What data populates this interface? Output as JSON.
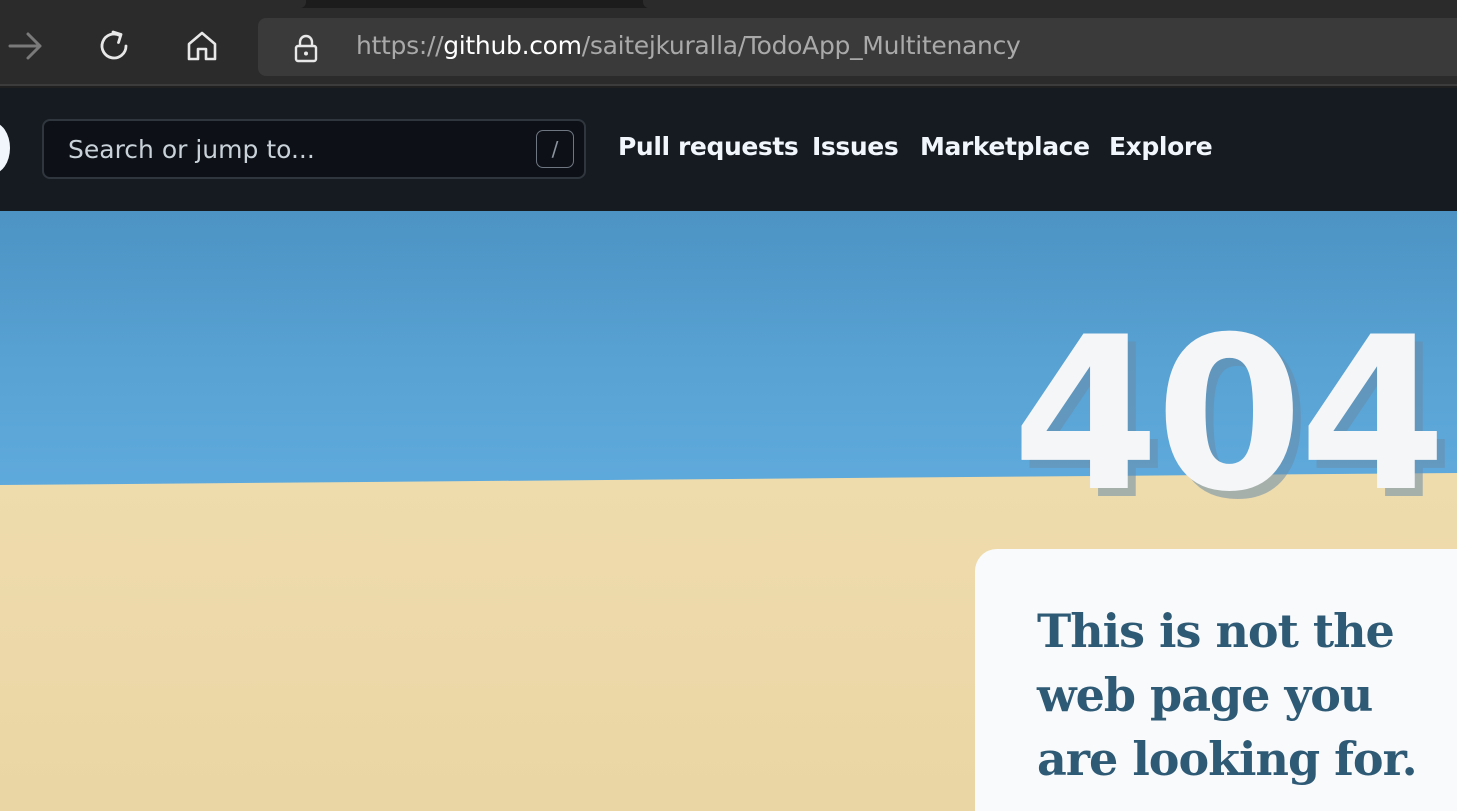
{
  "browser": {
    "url_prefix": "https://",
    "url_host": "github.com",
    "url_path": "/saitejkuralla/TodoApp_Multitenancy",
    "icons": [
      "forward-icon",
      "refresh-icon",
      "home-icon",
      "lock-icon"
    ]
  },
  "header": {
    "search_placeholder": "Search or jump to...",
    "search_shortcut": "/",
    "nav": {
      "pull_requests": "Pull requests",
      "issues": "Issues",
      "marketplace": "Marketplace",
      "explore": "Explore"
    }
  },
  "error": {
    "code": "404",
    "message": "This is not the web page you are looking for."
  },
  "colors": {
    "header_bg": "#161b22",
    "sky": "#62ade0",
    "sand": "#eedcb0",
    "message_text": "#2f5a76"
  }
}
